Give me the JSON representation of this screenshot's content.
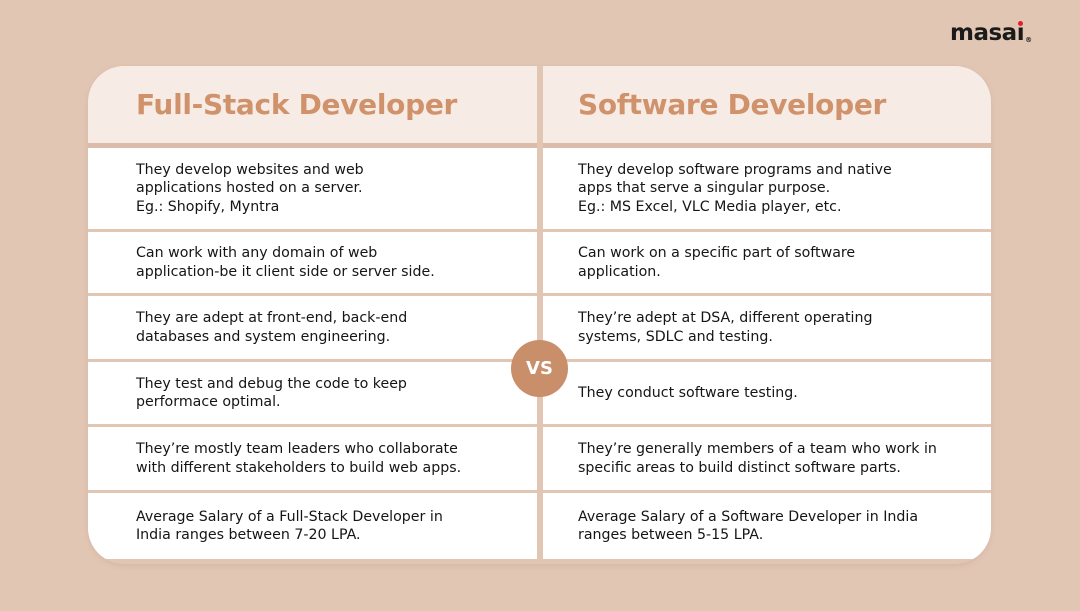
{
  "brand": {
    "logo_text_main": "masa",
    "logo_text_i": "ı",
    "logo_registered": "®",
    "accent_dot_color": "#e0202f"
  },
  "colors": {
    "background": "#e2c6b4",
    "header_bg": "#f6ebe5",
    "header_text": "#d0926b",
    "vs_badge": "#c98e6a"
  },
  "comparison": {
    "vs_label": "VS",
    "left": {
      "title": "Full-Stack Developer",
      "rows": [
        "They develop websites and web\napplications hosted on a server.\nEg.: Shopify, Myntra",
        "Can work with any domain of web\napplication-be it client side or server side.",
        "They are adept at front-end, back-end\ndatabases and system engineering.",
        "They test and debug the code to keep\nperformace optimal.",
        "They’re mostly team leaders who collaborate\nwith different stakeholders to build web apps.",
        "Average Salary of a Full-Stack Developer in\nIndia ranges between 7-20 LPA."
      ]
    },
    "right": {
      "title": "Software Developer",
      "rows": [
        "They develop software programs and native\napps that serve a singular purpose.\nEg.: MS Excel, VLC Media player, etc.",
        "Can work on a specific part of software\napplication.",
        "They’re adept at DSA, different operating\nsystems, SDLC and testing.",
        "They conduct software testing.",
        "They’re generally members of a team who work in\nspecific areas to build distinct software parts.",
        "Average Salary of a Software Developer in India\nranges between 5-15 LPA."
      ]
    }
  }
}
